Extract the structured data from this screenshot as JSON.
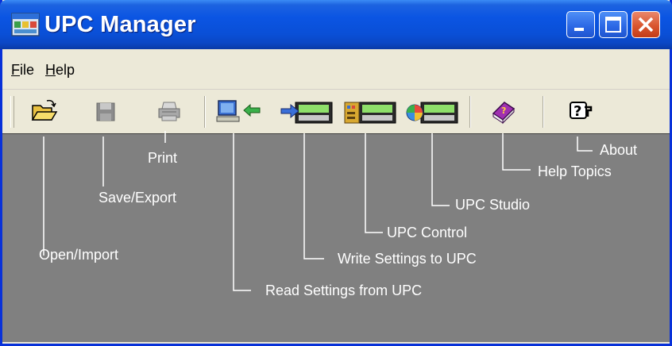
{
  "window": {
    "title": "UPC Manager",
    "title_icon": "upc-app-icon",
    "controls": [
      "minimize-icon",
      "maximize-icon",
      "close-icon"
    ]
  },
  "menu": {
    "file": "File",
    "help": "Help"
  },
  "toolbar": {
    "buttons": [
      {
        "name": "open-import",
        "icon": "open-folder-icon"
      },
      {
        "name": "save-export",
        "icon": "floppy-disk-icon"
      },
      {
        "name": "print",
        "icon": "printer-icon"
      },
      {
        "name": "read-settings",
        "icon": "computer-arrow-left-icon"
      },
      {
        "name": "write-settings",
        "icon": "arrow-to-device-icon"
      },
      {
        "name": "upc-control",
        "icon": "device-control-icon"
      },
      {
        "name": "upc-studio",
        "icon": "device-studio-icon"
      },
      {
        "name": "help-topics",
        "icon": "help-book-icon"
      },
      {
        "name": "about",
        "icon": "question-mark-icon"
      }
    ]
  },
  "callouts": {
    "open_import": "Open/Import",
    "save_export": "Save/Export",
    "print": "Print",
    "read_settings": "Read Settings from UPC",
    "write_settings": "Write Settings to UPC",
    "upc_control": "UPC Control",
    "upc_studio": "UPC Studio",
    "help_topics": "Help Topics",
    "about": "About"
  },
  "colors": {
    "titlebar": "#0b55e3",
    "workspace": "#808080",
    "frame": "#ece9d8",
    "close_button": "#d9562f",
    "callout_text": "#ffffff"
  }
}
